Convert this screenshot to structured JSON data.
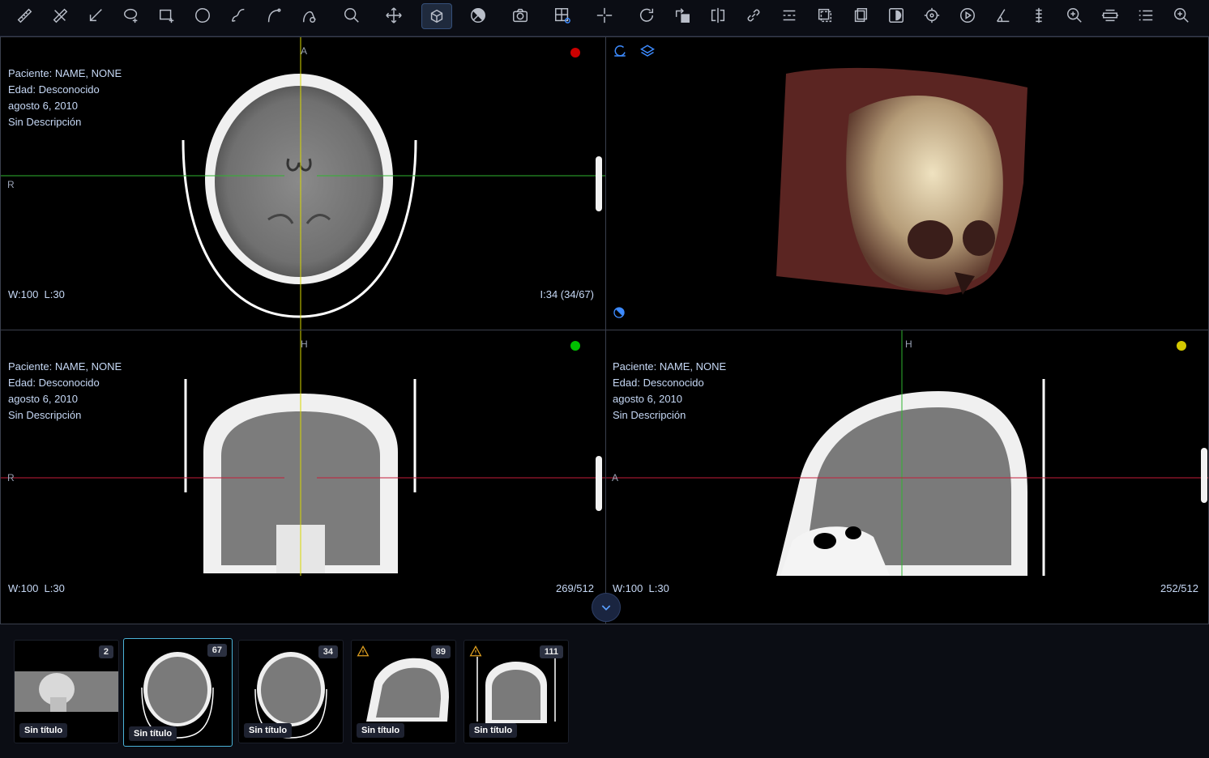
{
  "toolbar": {
    "tools": [
      "ruler-icon",
      "angle-ruler-icon",
      "arrow-annotate-icon",
      "lasso-roi-icon",
      "rectangle-roi-icon",
      "ellipse-roi-icon",
      "freehand-icon",
      "bezier-icon",
      "spline-icon",
      "zoom-icon",
      "pan-icon",
      "rotate-3d-icon",
      "window-level-icon",
      "capture-icon",
      "layout-settings-icon",
      "crosshair-icon",
      "reset-icon",
      "rotate-view-icon",
      "flip-icon",
      "link-icon",
      "sync-icon",
      "clone-icon",
      "stack-icon",
      "invert-icon",
      "target-icon",
      "cine-play-icon",
      "angle-icon",
      "probe-icon",
      "magnify-icon",
      "scroll-icon",
      "list-icon",
      "zoom-in-icon"
    ],
    "active_tool": "rotate-3d-icon"
  },
  "viewports": {
    "axial": {
      "patient": "Paciente: NAME, NONE",
      "age": "Edad: Desconocido",
      "date": "agosto 6, 2010",
      "description": "Sin Descripción",
      "wl": "W:100  L:30",
      "image_index": "I:34 (34/67)",
      "top_marker": "A",
      "left_marker": "R",
      "dot_color": "#cc0000"
    },
    "volume": {},
    "coronal": {
      "patient": "Paciente: NAME, NONE",
      "age": "Edad: Desconocido",
      "date": "agosto 6, 2010",
      "description": "Sin Descripción",
      "wl": "W:100  L:30",
      "image_index": "269/512",
      "top_marker": "H",
      "left_marker": "R",
      "dot_color": "#00c000"
    },
    "sagittal": {
      "patient": "Paciente: NAME, NONE",
      "age": "Edad: Desconocido",
      "date": "agosto 6, 2010",
      "description": "Sin Descripción",
      "wl": "W:100  L:30",
      "image_index": "252/512",
      "top_marker": "H",
      "left_marker": "A",
      "dot_color": "#d4c800"
    }
  },
  "thumbnails": [
    {
      "count": "2",
      "label": "Sin título",
      "warning": false,
      "selected": false
    },
    {
      "count": "67",
      "label": "Sin título",
      "warning": false,
      "selected": true
    },
    {
      "count": "34",
      "label": "Sin título",
      "warning": false,
      "selected": false
    },
    {
      "count": "89",
      "label": "Sin título",
      "warning": true,
      "selected": false
    },
    {
      "count": "111",
      "label": "Sin título",
      "warning": true,
      "selected": false
    }
  ]
}
